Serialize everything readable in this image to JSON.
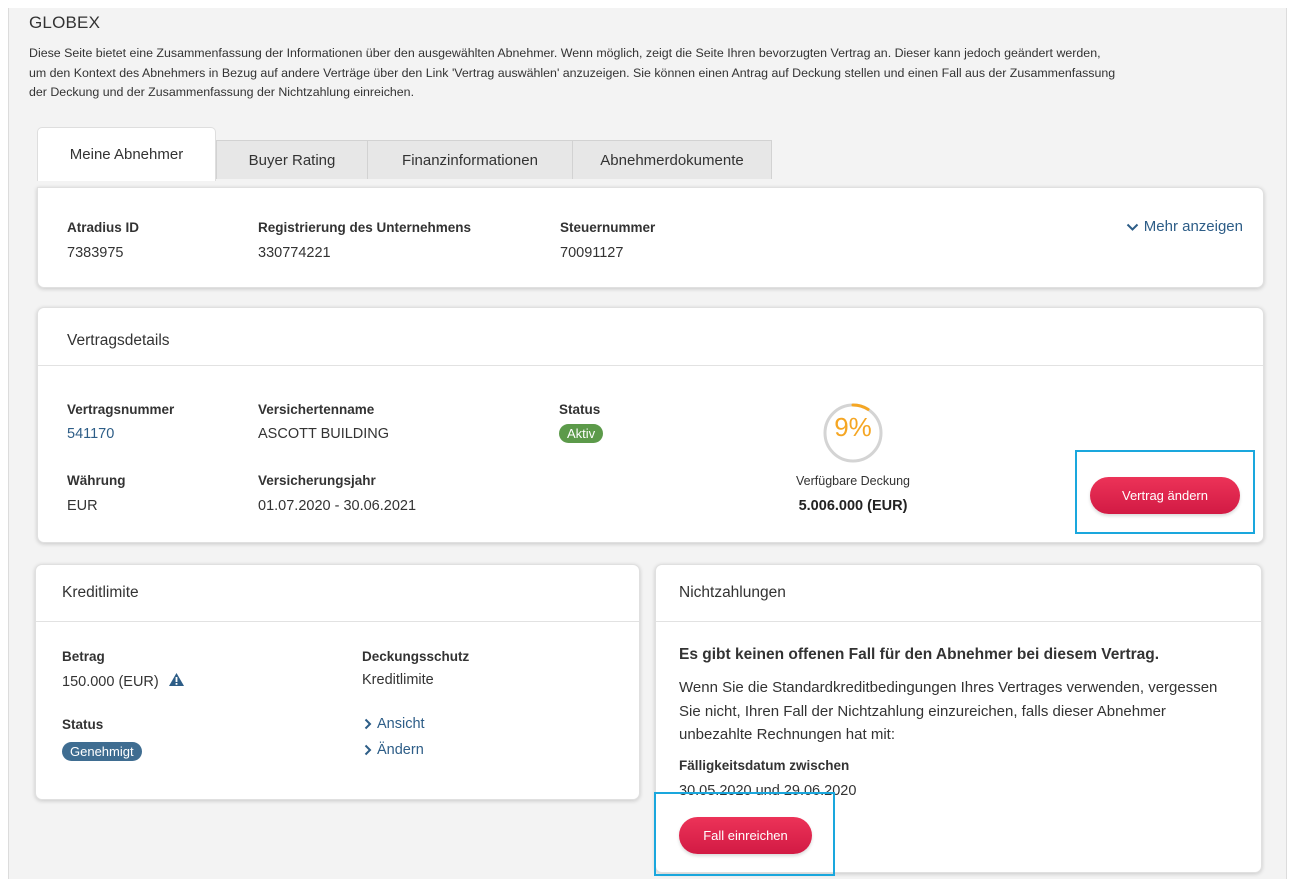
{
  "page": {
    "title": "GLOBEX",
    "intro": "Diese Seite bietet eine Zusammenfassung der Informationen über den ausgewählten Abnehmer. Wenn möglich, zeigt die Seite Ihren bevorzugten Vertrag an. Dieser kann jedoch geändert werden, um den Kontext des Abnehmers in Bezug auf andere Verträge über den Link 'Vertrag auswählen' anzuzeigen. Sie können einen Antrag auf Deckung stellen und einen Fall aus der Zusammenfassung der Deckung und der Zusammenfassung der Nichtzahlung einreichen."
  },
  "tabs": [
    {
      "label": "Meine Abnehmer",
      "active": true
    },
    {
      "label": "Buyer Rating",
      "active": false
    },
    {
      "label": "Finanzinformationen",
      "active": false
    },
    {
      "label": "Abnehmerdokumente",
      "active": false
    }
  ],
  "buyer": {
    "atradius_id_label": "Atradius ID",
    "atradius_id": "7383975",
    "registration_label": "Registrierung des Unternehmens",
    "registration": "330774221",
    "tax_label": "Steuernummer",
    "tax": "70091127",
    "more_link": "Mehr anzeigen",
    "more_icon": "chevron-down-icon"
  },
  "contract": {
    "header": "Vertragsdetails",
    "number_label": "Vertragsnummer",
    "number": "541170",
    "insured_label": "Versichertenname",
    "insured": "ASCOTT BUILDING",
    "status_label": "Status",
    "status": "Aktiv",
    "currency_label": "Währung",
    "currency": "EUR",
    "year_label": "Versicherungsjahr",
    "year": "01.07.2020 - 30.06.2021",
    "gauge_text": "9%",
    "gauge_fraction": 0.09,
    "available_label": "Verfügbare Deckung",
    "available_value": "5.006.000 (EUR)",
    "change_button": "Vertrag ändern"
  },
  "credit_limit": {
    "header": "Kreditlimite",
    "amount_label": "Betrag",
    "amount": "150.000 (EUR)",
    "amount_icon": "warning-icon",
    "protection_label": "Deckungsschutz",
    "protection": "Kreditlimite",
    "status_label": "Status",
    "status": "Genehmigt",
    "view_link": "Ansicht",
    "change_link": "Ändern"
  },
  "nonpayment": {
    "header": "Nichtzahlungen",
    "headline": "Es gibt keinen offenen Fall für den Abnehmer bei diesem Vertrag.",
    "body": "Wenn Sie die Standardkreditbedingungen Ihres Vertrages verwenden, vergessen Sie nicht, Ihren Fall der Nichtzahlung einzureichen, falls dieser Abnehmer unbezahlte Rechnungen hat mit:",
    "due_label": "Fälligkeitsdatum zwischen",
    "due_value": "30.05.2020 und 29.06.2020",
    "submit_button": "Fall einreichen"
  },
  "colors": {
    "accent_red": "#d21a44",
    "status_green": "#5c9a4a",
    "status_blue": "#3f6d91",
    "link_blue": "#2d5d87",
    "gauge_orange": "#f5a623",
    "highlight_cyan": "#1aa7dd"
  }
}
